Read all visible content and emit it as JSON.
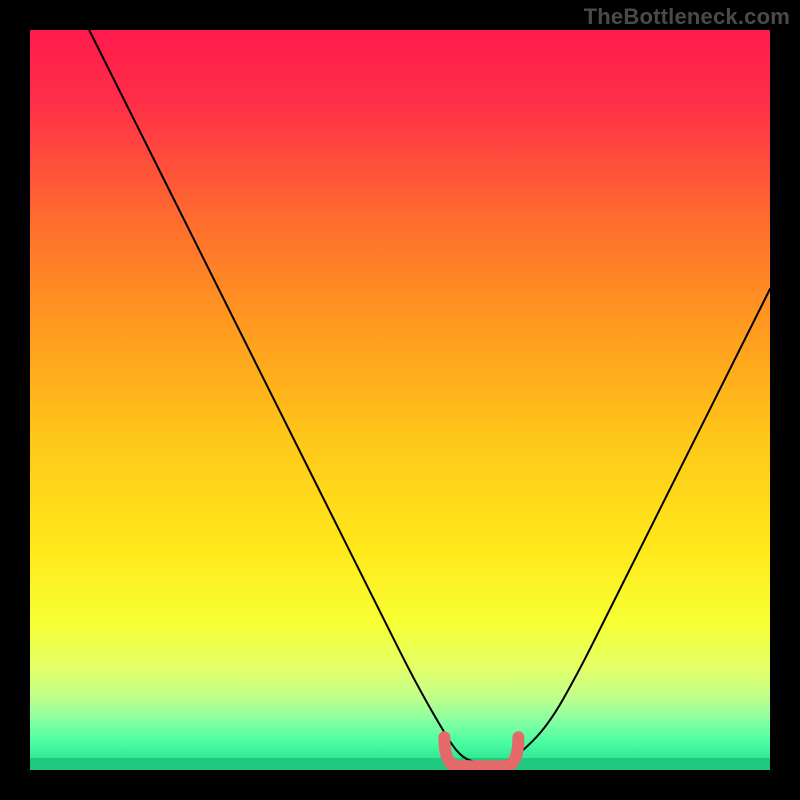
{
  "watermark": "TheBottleneck.com",
  "colors": {
    "gradient_stops": [
      {
        "offset": 0.0,
        "color": "#ff1a4d"
      },
      {
        "offset": 0.1,
        "color": "#ff2f48"
      },
      {
        "offset": 0.25,
        "color": "#ff6a2f"
      },
      {
        "offset": 0.4,
        "color": "#ff9a1f"
      },
      {
        "offset": 0.55,
        "color": "#ffc61a"
      },
      {
        "offset": 0.7,
        "color": "#ffe81a"
      },
      {
        "offset": 0.8,
        "color": "#f7ff33"
      },
      {
        "offset": 0.86,
        "color": "#e4ff66"
      },
      {
        "offset": 0.9,
        "color": "#c2ff8a"
      },
      {
        "offset": 0.93,
        "color": "#8cffa0"
      },
      {
        "offset": 0.96,
        "color": "#4effa3"
      },
      {
        "offset": 1.0,
        "color": "#21d88a"
      }
    ],
    "curve": "#000000",
    "highlight": "#e46a6a"
  },
  "chart_data": {
    "type": "line",
    "title": "",
    "xlabel": "",
    "ylabel": "",
    "xlim": [
      0,
      100
    ],
    "ylim": [
      0,
      100
    ],
    "legend": false,
    "grid": false,
    "series": [
      {
        "name": "bottleneck-curve",
        "x": [
          8,
          12,
          16,
          20,
          24,
          28,
          32,
          36,
          40,
          44,
          48,
          52,
          56,
          58,
          60,
          62,
          64,
          66,
          70,
          74,
          78,
          82,
          86,
          90,
          94,
          98,
          100
        ],
        "y": [
          100,
          92,
          84,
          76,
          68,
          60,
          52,
          44,
          36,
          28,
          20,
          12,
          5,
          2,
          1,
          1,
          1,
          2,
          6,
          13,
          21,
          29,
          37,
          45,
          53,
          61,
          65
        ]
      }
    ],
    "highlight_range": {
      "name": "optimal-zone-marker",
      "x_start": 56,
      "x_end": 66,
      "y": 2,
      "stroke_width": 12
    }
  }
}
